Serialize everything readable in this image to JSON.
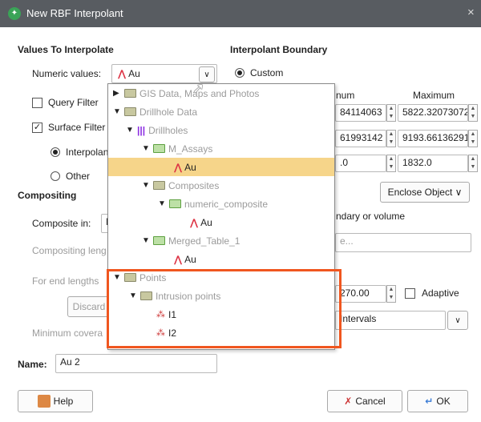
{
  "window": {
    "title": "New RBF Interpolant",
    "close_glyph": "×"
  },
  "values_section": {
    "heading": "Values To Interpolate",
    "numeric_label": "Numeric values:",
    "numeric_value": "Au",
    "query_filter_label": "Query Filter",
    "surface_filter_label": "Surface Filter",
    "interpolant_label": "Interpolan",
    "other_label": "Other"
  },
  "boundary": {
    "heading": "Interpolant Boundary",
    "custom_label": "Custom",
    "minimum_header": "num",
    "maximum_header": "Maximum",
    "rows": [
      {
        "min": "84114063",
        "max": "5822.32073072"
      },
      {
        "min": "61993142",
        "max": "9193.66136291"
      },
      {
        "min": ".0",
        "max": "1832.0"
      }
    ],
    "enclose_label": "Enclose Object ∨",
    "boundary_text": "ndary or volume",
    "boundary_field": "e..."
  },
  "compositing": {
    "heading": "Compositing",
    "composite_in_label": "Composite in:",
    "composite_in_value": "N",
    "compositing_length_label": "Compositing leng",
    "end_lengths_label": "For end lengths",
    "discard_label": "Discard",
    "min_coverage_label": "Minimum covera",
    "value_field": "270.00",
    "adaptive_label": "Adaptive",
    "intervals_value": "Intervals"
  },
  "dropdown": {
    "items": [
      {
        "label": "GIS Data, Maps and Photos"
      },
      {
        "label": "Drillhole Data"
      },
      {
        "label": "Drillholes"
      },
      {
        "label": "M_Assays"
      },
      {
        "label": "Au"
      },
      {
        "label": "Composites"
      },
      {
        "label": "numeric_composite"
      },
      {
        "label": "Au"
      },
      {
        "label": "Merged_Table_1"
      },
      {
        "label": "Au"
      },
      {
        "label": "Points"
      },
      {
        "label": "Intrusion points"
      },
      {
        "label": "I1"
      },
      {
        "label": "I2"
      }
    ]
  },
  "name_field": {
    "label": "Name:",
    "value": "Au 2"
  },
  "buttons": {
    "help": "Help",
    "cancel": "Cancel",
    "ok": "OK"
  },
  "colors": {
    "titlebar": "#585c61",
    "highlight": "#f6d58a",
    "callout": "#f0561f"
  }
}
